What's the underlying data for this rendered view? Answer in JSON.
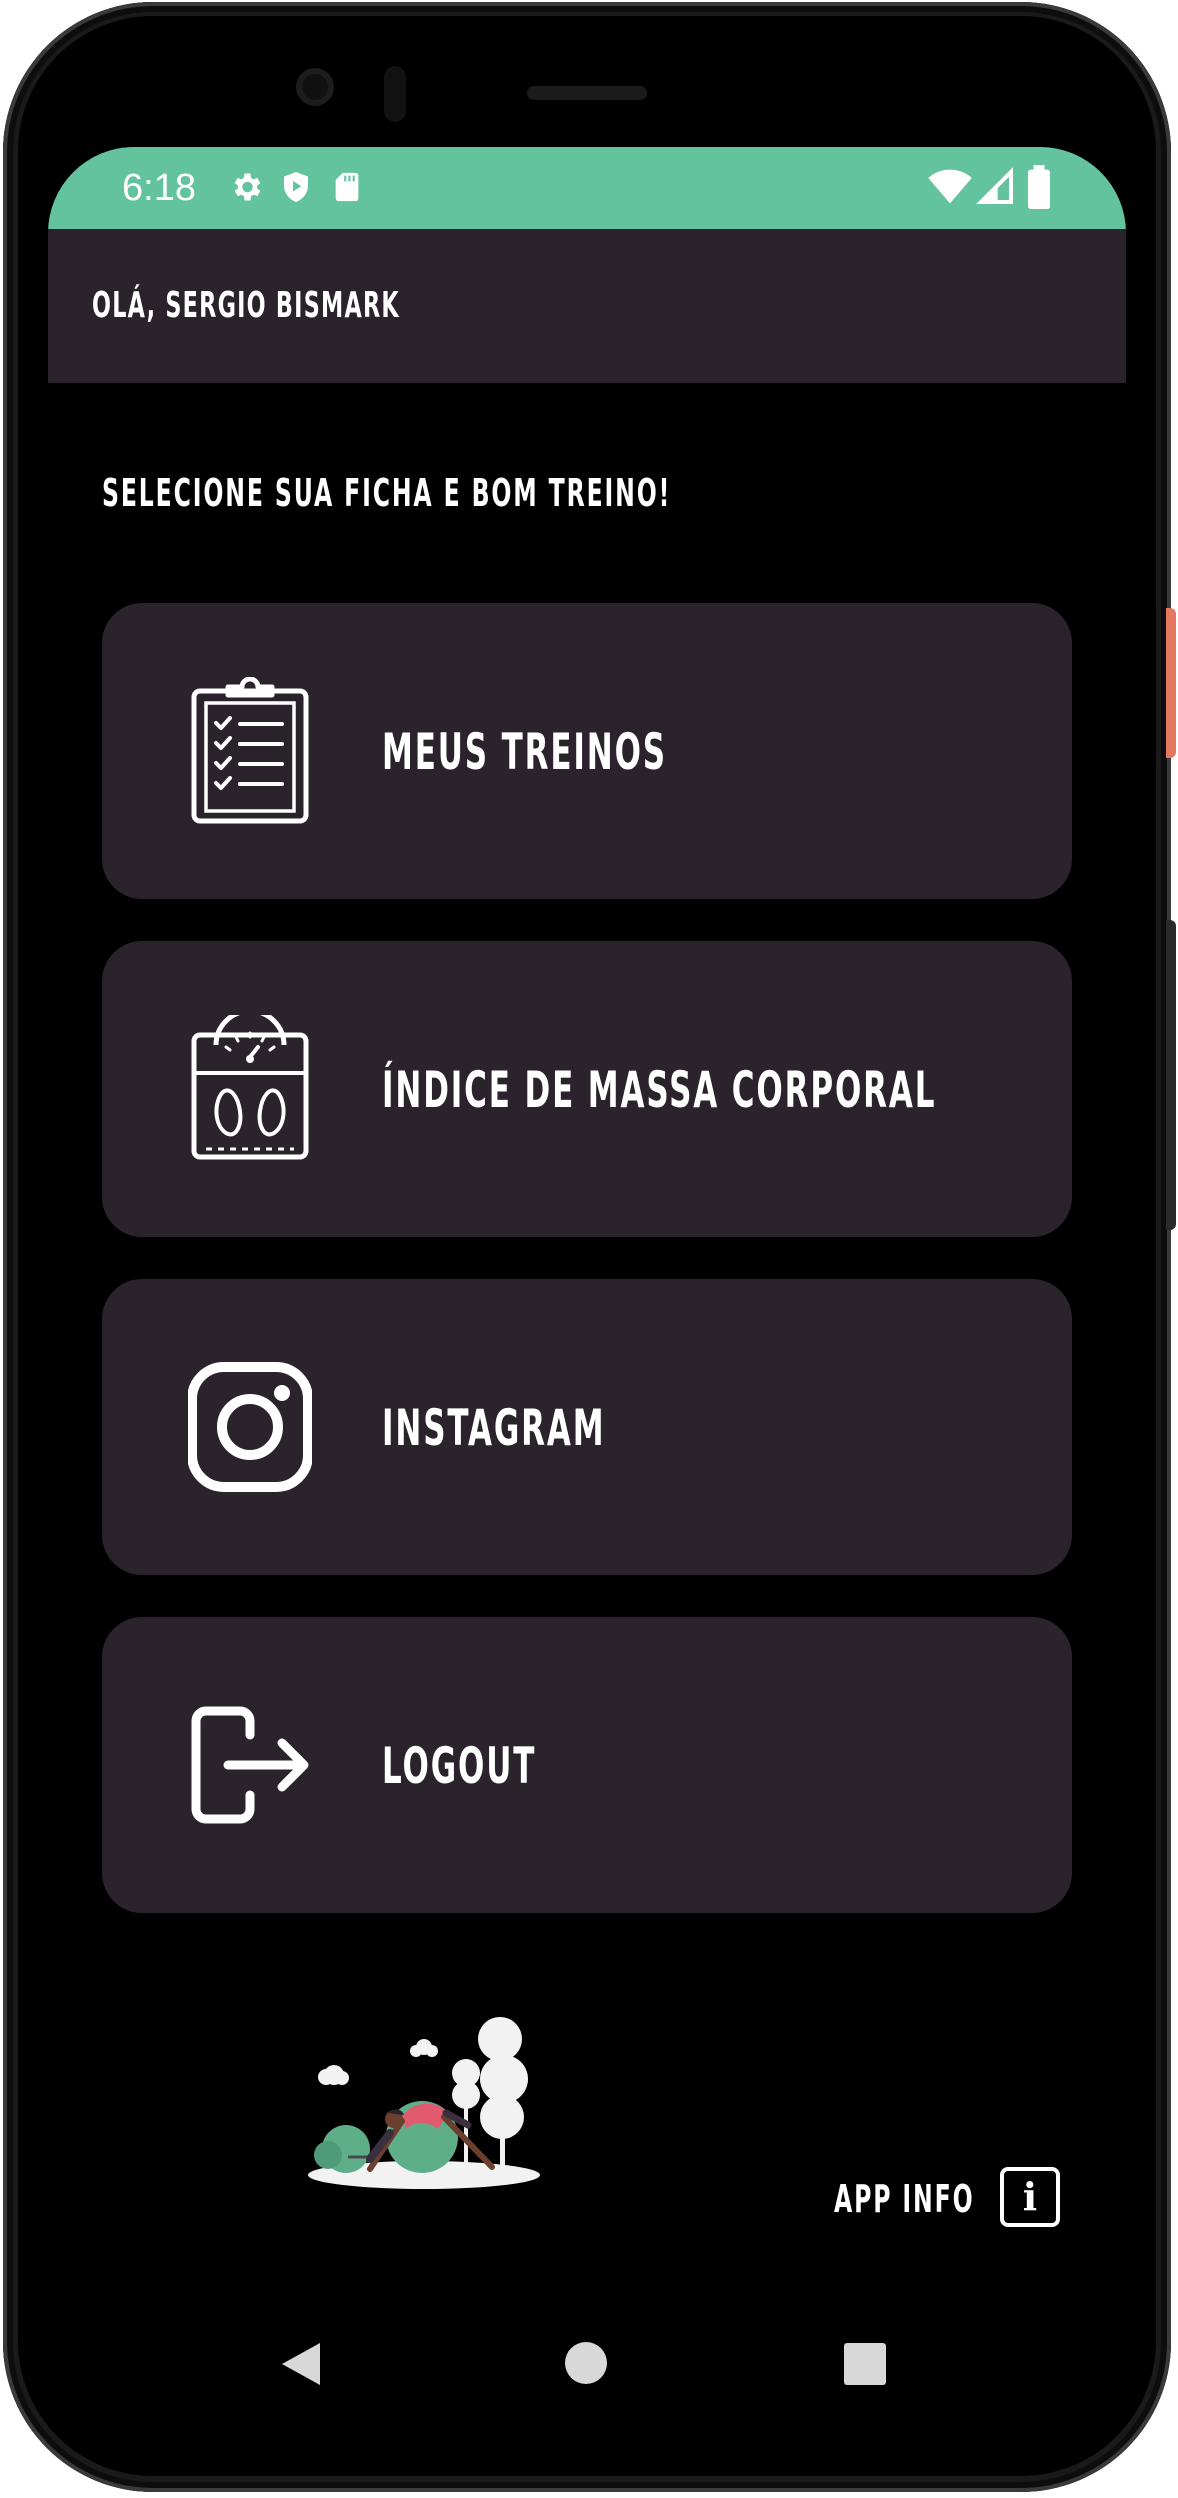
{
  "status_bar": {
    "time": "6:18",
    "left_icons": [
      "gear-icon",
      "shield-play-icon",
      "sd-card-icon"
    ],
    "right_icons": [
      "wifi-icon",
      "signal-icon",
      "battery-icon"
    ],
    "color": "#62c39e"
  },
  "header": {
    "greeting": "OLÁ, SERGIO BISMARK"
  },
  "main": {
    "subtitle": "SELECIONE SUA FICHA E BOM TREINO!",
    "menu": [
      {
        "label": "MEUS TREINOS",
        "icon": "clipboard-checklist-icon"
      },
      {
        "label": "ÍNDICE DE MASSA CORPORAL",
        "icon": "body-scale-icon"
      },
      {
        "label": "INSTAGRAM",
        "icon": "instagram-icon"
      },
      {
        "label": "LOGOUT",
        "icon": "logout-icon"
      }
    ]
  },
  "footer": {
    "illustration": "workout-illustration",
    "app_info_label": "APP INFO",
    "info_icon_glyph": "i"
  },
  "nav": {
    "back": "back-icon",
    "home": "home-icon",
    "recents": "recents-icon"
  },
  "colors": {
    "background": "#000000",
    "card": "#2a232b",
    "accent": "#62c39e",
    "text": "#ffffff"
  }
}
